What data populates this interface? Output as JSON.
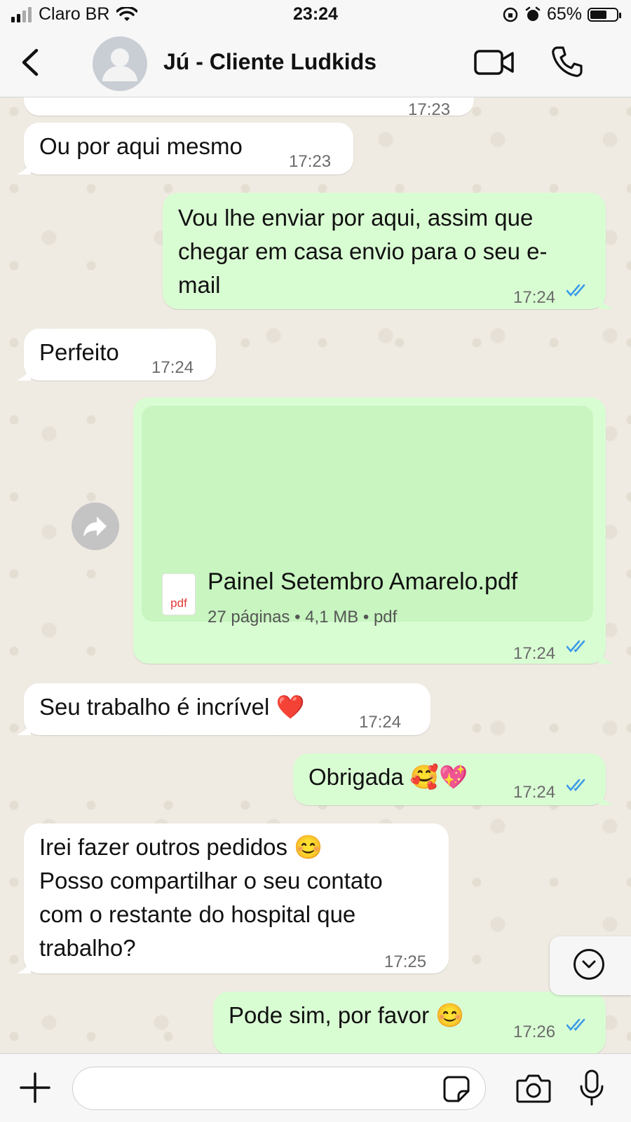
{
  "status_bar": {
    "carrier": "Claro BR",
    "time": "23:24",
    "battery": "65%",
    "battery_level": 0.65
  },
  "header": {
    "contact_name": "Jú - Cliente Ludkids",
    "back_icon": "chevron-left-icon",
    "video_icon": "video-camera-icon",
    "call_icon": "phone-icon"
  },
  "messages": [
    {
      "direction": "in",
      "time": "17:23",
      "partial": true
    },
    {
      "direction": "in",
      "text": "Ou por aqui mesmo",
      "time": "17:23"
    },
    {
      "direction": "out",
      "lines": [
        "Vou lhe enviar por aqui, assim que",
        "chegar em casa envio para o seu e-",
        "mail"
      ],
      "time": "17:24",
      "read": true
    },
    {
      "direction": "in",
      "text": "Perfeito",
      "time": "17:24"
    },
    {
      "direction": "out",
      "type": "document",
      "file_name": "Painel Setembro Amarelo.pdf",
      "file_meta": "27 páginas • 4,1 MB • pdf",
      "file_icon_label": "pdf",
      "time": "17:24",
      "read": true
    },
    {
      "direction": "in",
      "text": "Seu trabalho é incrível ❤️",
      "time": "17:24"
    },
    {
      "direction": "out",
      "text": "Obrigada 🥰💖",
      "time": "17:24",
      "read": true
    },
    {
      "direction": "in",
      "lines": [
        "Irei fazer outros pedidos 😊",
        "Posso compartilhar o seu contato",
        "com o restante do hospital que",
        "trabalho?"
      ],
      "time": "17:25"
    },
    {
      "direction": "out",
      "text": "Pode sim, por favor 😊",
      "time": "17:26",
      "read": true
    }
  ],
  "composer": {
    "placeholder": "",
    "icons": [
      "plus-icon",
      "sticker-icon",
      "camera-icon",
      "microphone-icon"
    ]
  },
  "colors": {
    "incoming_bubble": "#ffffff",
    "outgoing_bubble": "#d9fdd3",
    "read_ticks": "#3b9be8",
    "chat_background": "#efeae2"
  }
}
